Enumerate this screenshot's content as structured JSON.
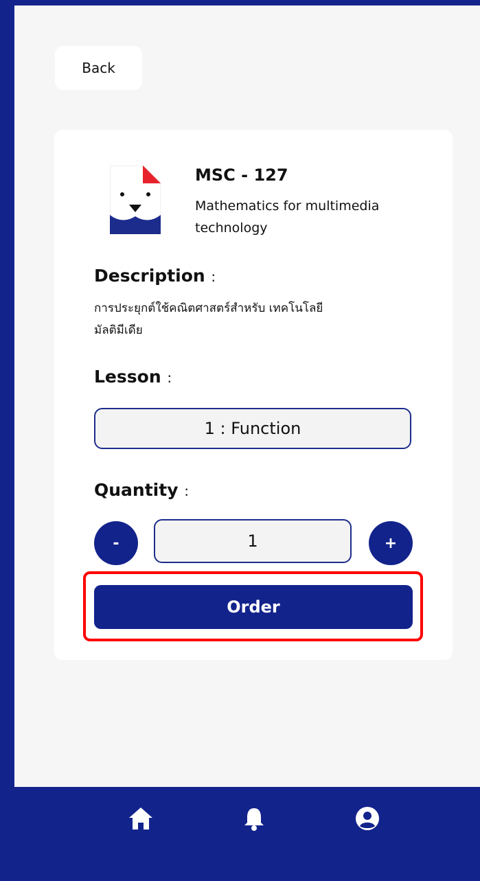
{
  "header": {
    "back_label": "Back"
  },
  "course": {
    "code": "MSC - 127",
    "name": "Mathematics for multimedia technology",
    "description_label": "Description",
    "description": "การประยุกต์ใช้คณิตศาสตร์สำหรับ เทคโนโลยีมัลติมีเดีย",
    "lesson_label": "Lesson",
    "lesson_value": "1 : Function",
    "quantity_label": "Quantity",
    "quantity_value": "1",
    "minus_label": "-",
    "plus_label": "+",
    "order_label": "Order",
    "colon": ":"
  },
  "bottom_nav": {
    "items": [
      {
        "icon": "home-icon"
      },
      {
        "icon": "bell-icon"
      },
      {
        "icon": "user-circle-icon"
      }
    ]
  },
  "colors": {
    "primary": "#13238c",
    "background": "#f6f6f6",
    "card": "#ffffff",
    "highlight": "#ff0000",
    "logo_accent": "#e8222c"
  }
}
